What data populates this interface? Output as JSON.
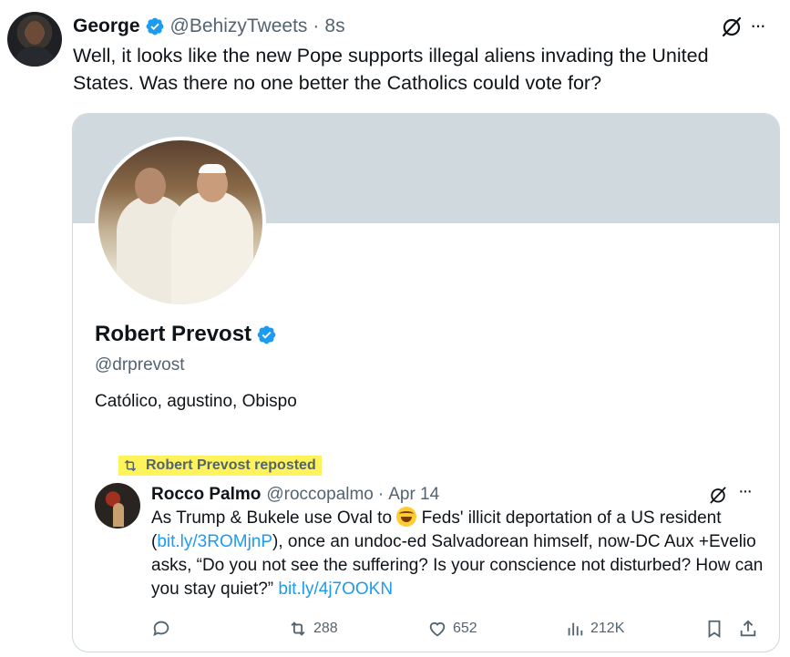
{
  "tweet": {
    "author_name": "George",
    "author_handle": "@BehizyTweets",
    "separator": "·",
    "time": "8s",
    "text": "Well, it looks like the new Pope supports illegal aliens invading the United States. Was there no one better the Catholics could vote for?",
    "more_label": "···"
  },
  "profile_card": {
    "name": "Robert Prevost",
    "handle": "@drprevost",
    "bio": "Católico, agustino, Obispo",
    "repost_label": "Robert Prevost reposted",
    "banner_color": "#cfd9de",
    "highlight_color": "#fff35c"
  },
  "reposted_tweet": {
    "author_name": "Rocco Palmo",
    "author_handle": "@roccopalmo",
    "separator": "·",
    "date": "Apr 14",
    "more_label": "···",
    "text_part1": "As Trump & Bukele use Oval to ",
    "emoji_icon": "rolling-on-floor-laughing-emoji",
    "text_part2": " Feds' illicit deportation of a US resident (",
    "link1": "bit.ly/3ROMjnP",
    "text_part3": "), once an undoc-ed Salvadorean himself, now-DC Aux +Evelio asks, “Do you not see the suffering? Is your conscience not disturbed? How can you stay quiet?” ",
    "link2": "bit.ly/4j7OOKN"
  },
  "actions": {
    "reply_count": "",
    "retweet_count": "288",
    "like_count": "652",
    "views_count": "212K"
  },
  "colors": {
    "verified": "#1d9bf0",
    "link": "#1d9bf0",
    "secondary_text": "#536471"
  }
}
